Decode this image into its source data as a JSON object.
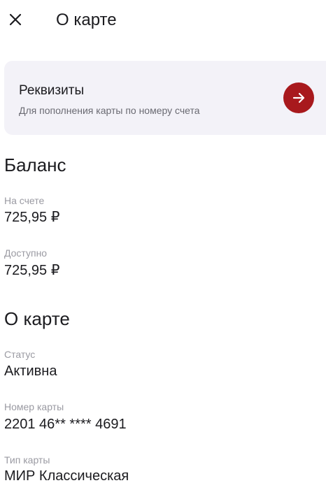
{
  "header": {
    "close_icon": "close-icon",
    "title": "О карте"
  },
  "requisites": {
    "title": "Реквизиты",
    "subtitle": "Для пополнения карты по номеру счета",
    "arrow_icon": "arrow-right-icon",
    "accent_color": "#a8191d"
  },
  "balance": {
    "section_title": "Баланс",
    "on_account_label": "На счете",
    "on_account_value": "725,95 ₽",
    "available_label": "Доступно",
    "available_value": "725,95 ₽"
  },
  "card_info": {
    "section_title": "О карте",
    "status_label": "Статус",
    "status_value": "Активна",
    "number_label": "Номер карты",
    "number_value": "2201 46** **** 4691",
    "type_label": "Тип карты",
    "type_value": "МИР Классическая"
  }
}
